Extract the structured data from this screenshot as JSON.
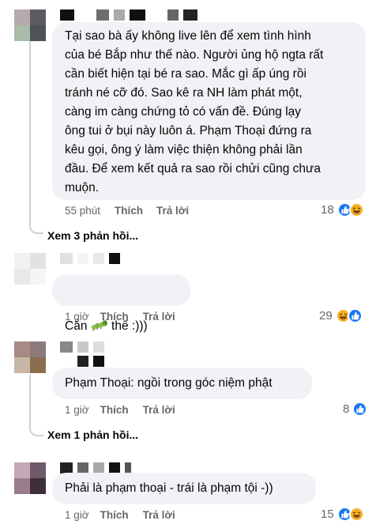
{
  "comments": [
    {
      "text": "Tại sao bà ấy không live lên để xem tình hình\ncủa bé Bắp như thế nào. Người ủng hộ ngta rất\ncần biết hiện tại bé ra sao. Mắc gì ấp úng rồi\ntránh né cỡ đó. Sao kê ra NH làm phát một,\ncàng im càng chứng tỏ có vấn đề. Đúng lạy\nông tui ở bụi này luôn á. Phạm Thoại đứng ra\nkêu gọi, ông ý làm việc thiện không phải lần\nđầu. Để xem kết quả ra sao rồi chửi cũng chưa\nmuộn.",
      "time": "55 phút",
      "like_label": "Thích",
      "reply_label": "Trả lời",
      "reaction_count": "18",
      "reactions": [
        "like-icon",
        "haha-icon"
      ],
      "view_replies": "Xem 3 phản hồi..."
    },
    {
      "text_before": "Cắn ",
      "emoji": "caterpillar-emoji",
      "text_after": " thế :)))",
      "time": "1 giờ",
      "like_label": "Thích",
      "reply_label": "Trả lời",
      "reaction_count": "29",
      "reactions": [
        "haha-icon",
        "like-icon"
      ]
    },
    {
      "text": "Phạm Thoại: ngồi trong góc niệm phật",
      "time": "1 giờ",
      "like_label": "Thích",
      "reply_label": "Trả lời",
      "reaction_count": "8",
      "reactions": [
        "like-icon"
      ],
      "view_replies": "Xem 1 phản hồi..."
    },
    {
      "text": "Phải là phạm thoại - trái là phạm tội -))",
      "time": "1 giờ",
      "like_label": "Thích",
      "reply_label": "Trả lời",
      "reaction_count": "15",
      "reactions": [
        "like-icon",
        "haha-icon"
      ]
    }
  ],
  "colors": {
    "bubble": "#f0f2f5",
    "meta_text": "#65676b",
    "like": "#1877f2",
    "haha": "#f7b125",
    "thread_line": "#ced0d4"
  }
}
